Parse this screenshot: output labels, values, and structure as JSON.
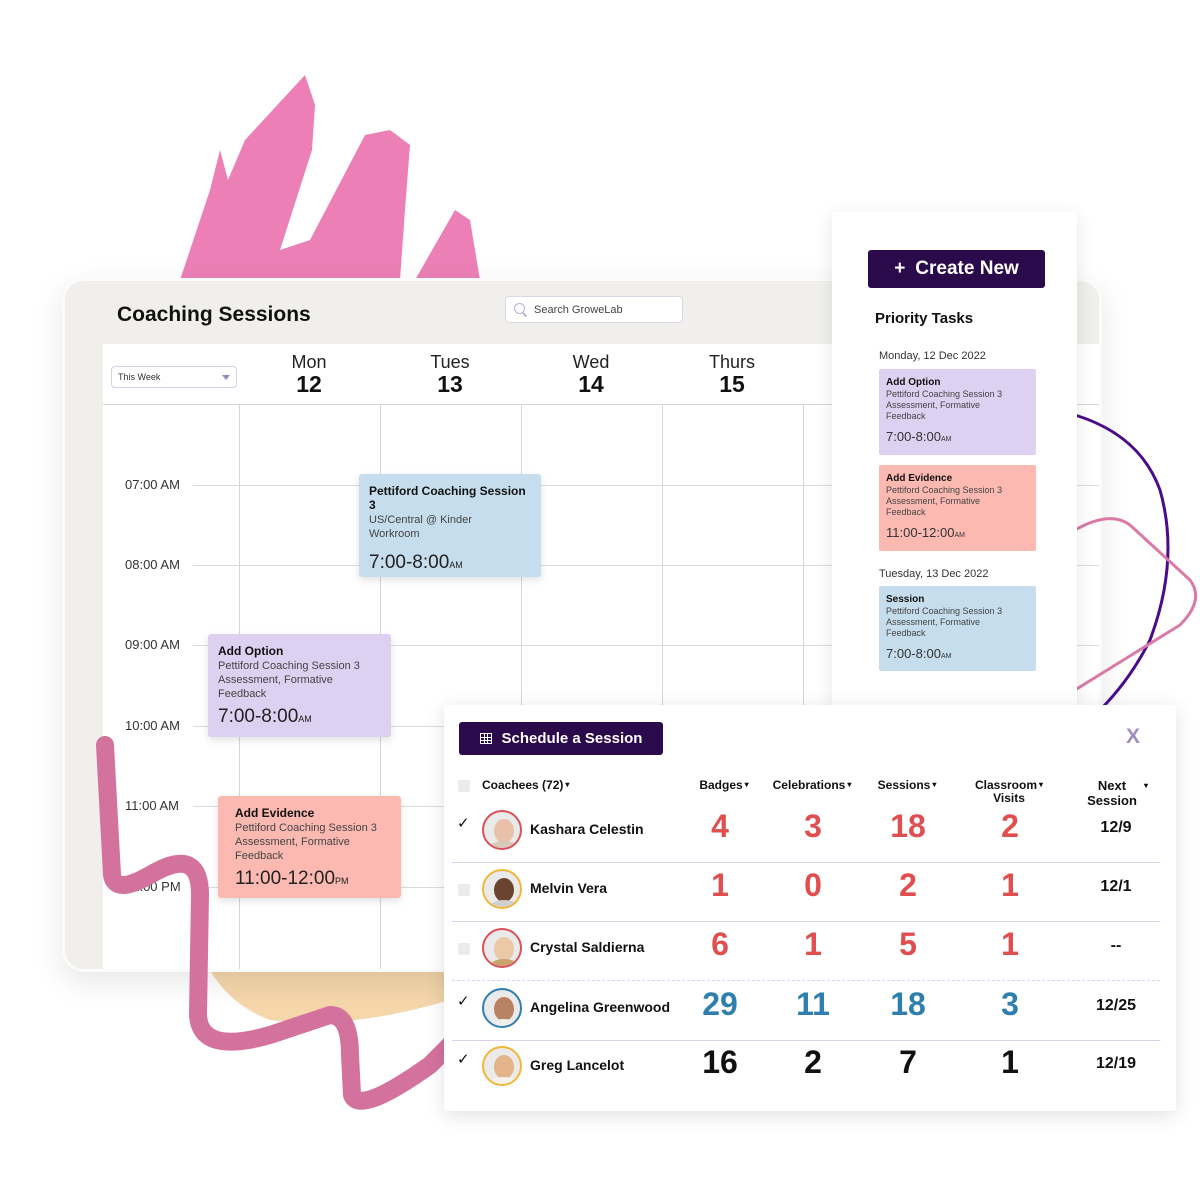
{
  "colors": {
    "brand_dark": "#2a0a4a",
    "accent_pink": "#ec80b6",
    "accent_purple_line": "#4a0c8a",
    "number_red": "#df4f50",
    "number_blue": "#2e7fad",
    "number_black": "#111111",
    "event_blue": "#c5ddec",
    "event_purple": "#ded0f0",
    "event_red": "#fbb9b2"
  },
  "calendar": {
    "title": "Coaching Sessions",
    "search_placeholder": "Search GroweLab",
    "range_select": "This Week",
    "days": [
      {
        "name": "Mon",
        "num": "12"
      },
      {
        "name": "Tues",
        "num": "13"
      },
      {
        "name": "Wed",
        "num": "14"
      },
      {
        "name": "Thurs",
        "num": "15"
      }
    ],
    "times": [
      "07:00 AM",
      "08:00 AM",
      "09:00 AM",
      "10:00 AM",
      "11:00 AM",
      "12:00 PM"
    ],
    "events": [
      {
        "title": "Pettiford Coaching Session 3",
        "line1": "US/Central @ Kinder",
        "line2": "Workroom",
        "line3": "",
        "time": "7:00-8:00",
        "meridiem": "AM",
        "day": "Tues"
      },
      {
        "title": "Add Option",
        "line1": "Pettiford Coaching Session 3",
        "line2": "Assessment, Formative",
        "line3": "Feedback",
        "time": "7:00-8:00",
        "meridiem": "AM",
        "day": "Mon"
      },
      {
        "title": "Add Evidence",
        "line1": "Pettiford Coaching Session 3",
        "line2": "Assessment, Formative",
        "line3": "Feedback",
        "time": "11:00-12:00",
        "meridiem": "PM",
        "day": "Mon"
      }
    ]
  },
  "priority": {
    "create_label": "Create New",
    "create_icon": "+",
    "title": "Priority Tasks",
    "groups": [
      {
        "date": "Monday, 12 Dec 2022",
        "tasks": [
          {
            "title": "Add Option",
            "line1": "Pettiford Coaching Session 3",
            "line2": "Assessment, Formative",
            "line3": "Feedback",
            "time": "7:00-8:00",
            "meridiem": "AM"
          },
          {
            "title": "Add Evidence",
            "line1": "Pettiford Coaching Session 3",
            "line2": "Assessment, Formative",
            "line3": "Feedback",
            "time": "11:00-12:00",
            "meridiem": "AM"
          }
        ]
      },
      {
        "date": "Tuesday, 13 Dec 2022",
        "tasks": [
          {
            "title": "Session",
            "line1": "Pettiford Coaching Session 3",
            "line2": "Assessment, Formative",
            "line3": "Feedback",
            "time": "7:00-8:00",
            "meridiem": "AM"
          }
        ]
      }
    ]
  },
  "schedule": {
    "button_label": "Schedule a Session",
    "close_label": "X",
    "columns": {
      "coachees": "Coachees (72)",
      "badges": "Badges",
      "celebrations": "Celebrations",
      "sessions": "Sessions",
      "classroom_1": "Classroom",
      "classroom_2": "Visits",
      "next_1": "Next",
      "next_2": "Session"
    },
    "caret": "▾",
    "check": "✓",
    "rows": [
      {
        "name": "Kashara Celestin",
        "checked": true,
        "badges": "4",
        "celebrations": "3",
        "sessions": "18",
        "visits": "2",
        "next": "12/9",
        "tone": "red"
      },
      {
        "name": "Melvin Vera",
        "checked": false,
        "badges": "1",
        "celebrations": "0",
        "sessions": "2",
        "visits": "1",
        "next": "12/1",
        "tone": "red"
      },
      {
        "name": "Crystal Saldierna",
        "checked": false,
        "badges": "6",
        "celebrations": "1",
        "sessions": "5",
        "visits": "1",
        "next": "--",
        "tone": "red"
      },
      {
        "name": "Angelina Greenwood",
        "checked": true,
        "badges": "29",
        "celebrations": "11",
        "sessions": "18",
        "visits": "3",
        "next": "12/25",
        "tone": "blue"
      },
      {
        "name": "Greg Lancelot",
        "checked": true,
        "badges": "16",
        "celebrations": "2",
        "sessions": "7",
        "visits": "1",
        "next": "12/19",
        "tone": "black"
      }
    ]
  }
}
